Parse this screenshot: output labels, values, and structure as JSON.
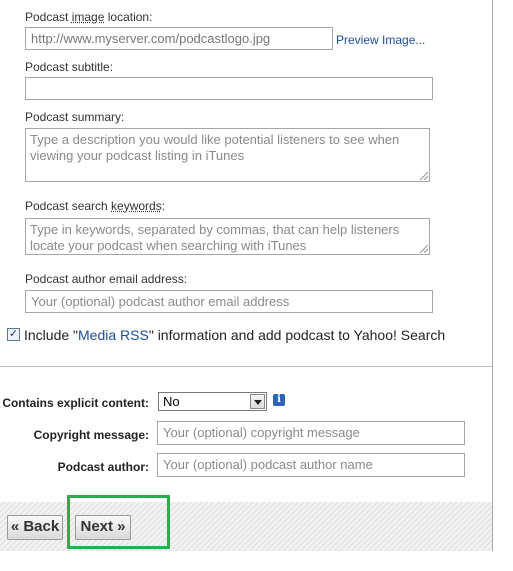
{
  "image_location": {
    "label_pre": "Podcast ",
    "label_u": "image",
    "label_post": " location:",
    "value": "http://www.myserver.com/podcastlogo.jpg",
    "preview_link": "Preview Image..."
  },
  "subtitle": {
    "label": "Podcast subtitle:",
    "value": ""
  },
  "summary": {
    "label": "Podcast summary:",
    "placeholder": "Type a description you would like potential listeners to see when viewing your podcast listing in iTunes"
  },
  "keywords": {
    "label_pre": "Podcast search ",
    "label_u": "keywords",
    "label_post": ":",
    "placeholder": "Type in keywords, separated by commas, that can help listeners locate your podcast when searching with iTunes"
  },
  "author_email": {
    "label": "Podcast author email address:",
    "placeholder": "Your (optional) podcast author email address"
  },
  "media_rss": {
    "checked": true,
    "pre": "Include \"",
    "link": "Media RSS",
    "post": "\" information and add podcast to Yahoo! Search"
  },
  "explicit": {
    "label": "Contains explicit content:",
    "value": "No",
    "info": "i"
  },
  "copyright": {
    "label": "Copyright message:",
    "placeholder": "Your (optional) copyright message"
  },
  "author": {
    "label": "Podcast author:",
    "placeholder": "Your (optional) podcast author name"
  },
  "nav": {
    "back": "« Back",
    "next": "Next »"
  }
}
